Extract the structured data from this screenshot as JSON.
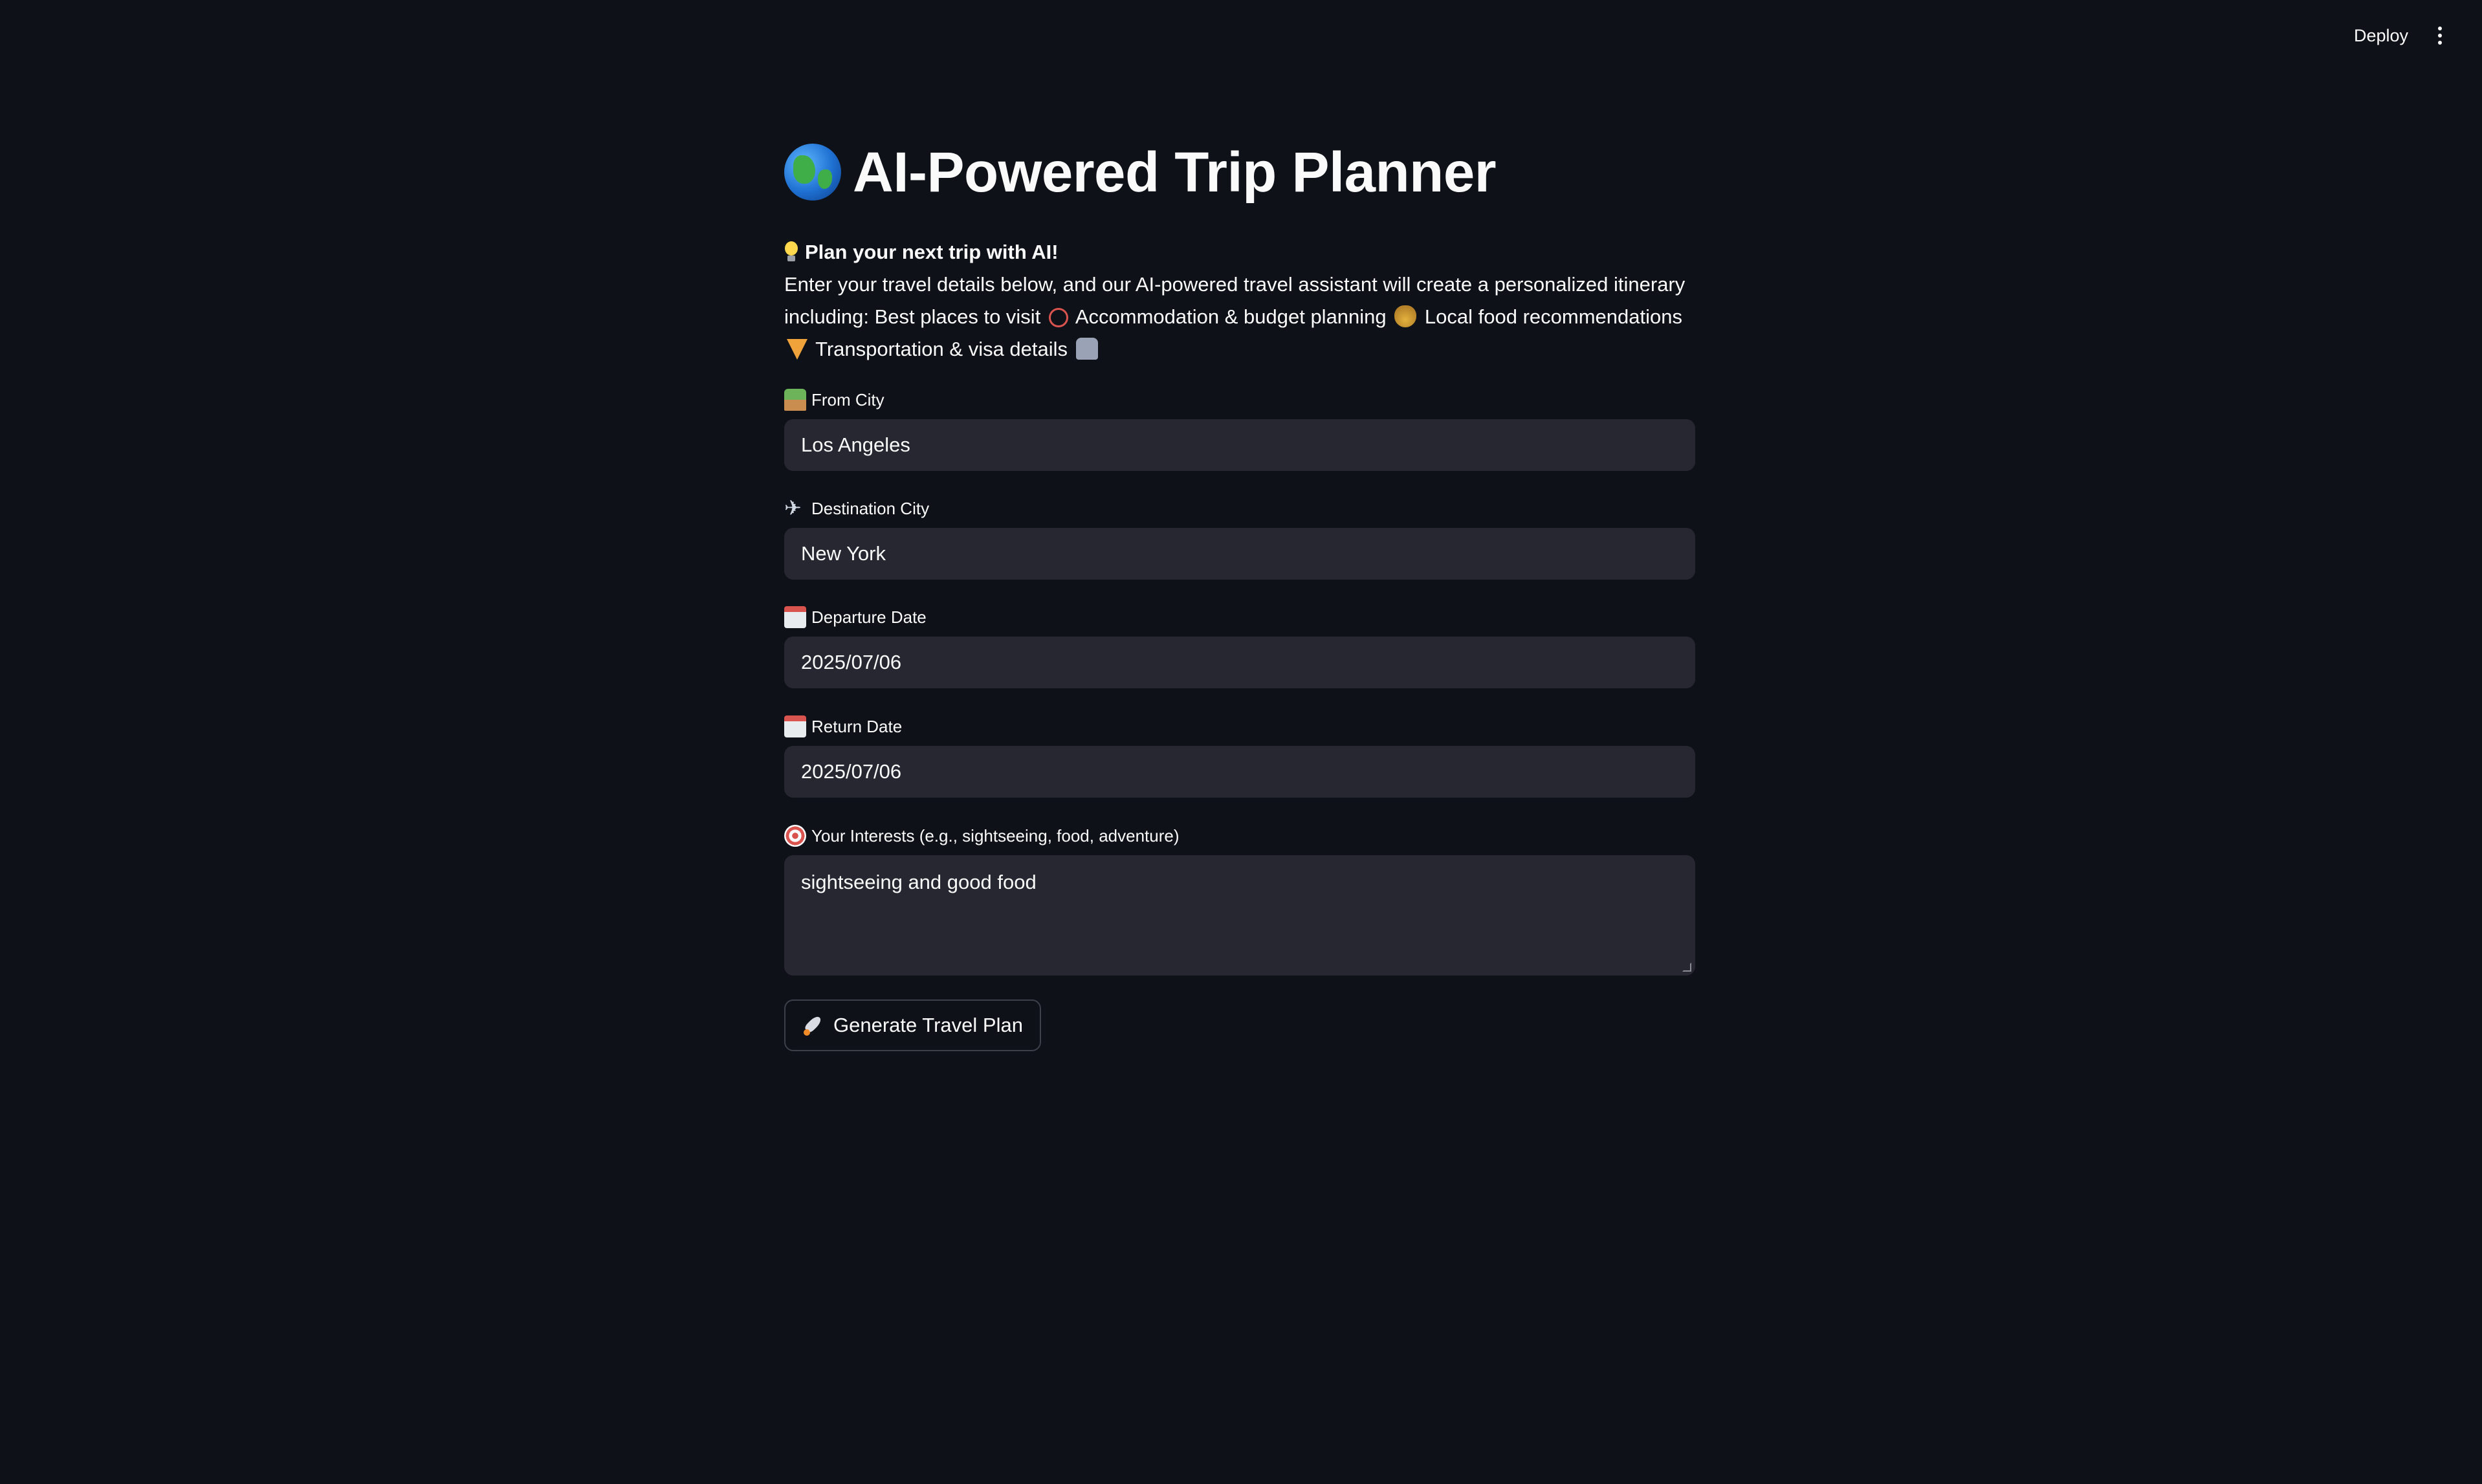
{
  "topbar": {
    "deploy_label": "Deploy",
    "menu_icon": "vertical-ellipsis-icon"
  },
  "header": {
    "title": "AI-Powered Trip Planner",
    "title_icon": "globe-icon"
  },
  "intro": {
    "heading": "Plan your next trip with AI!",
    "part1": "Enter your travel details below, and our AI-powered travel assistant will create a personalized itinerary including: Best places to visit",
    "part2": "Accommodation & budget planning",
    "part3": "Local food recommendations",
    "part4": "Transportation & visa details"
  },
  "form": {
    "from_city": {
      "label": "From City",
      "value": "Los Angeles",
      "icon": "house-icon"
    },
    "destination_city": {
      "label": "Destination City",
      "value": "New York",
      "icon": "airplane-icon"
    },
    "departure_date": {
      "label": "Departure Date",
      "value": "2025/07/06",
      "icon": "calendar-icon"
    },
    "return_date": {
      "label": "Return Date",
      "value": "2025/07/06",
      "icon": "calendar-icon"
    },
    "interests": {
      "label": "Your Interests (e.g., sightseeing, food, adventure)",
      "value": "sightseeing and good food",
      "icon": "target-icon"
    },
    "submit_label": "Generate Travel Plan"
  },
  "colors": {
    "background": "#0e1117",
    "input_background": "#262730",
    "text": "#fafafa"
  }
}
